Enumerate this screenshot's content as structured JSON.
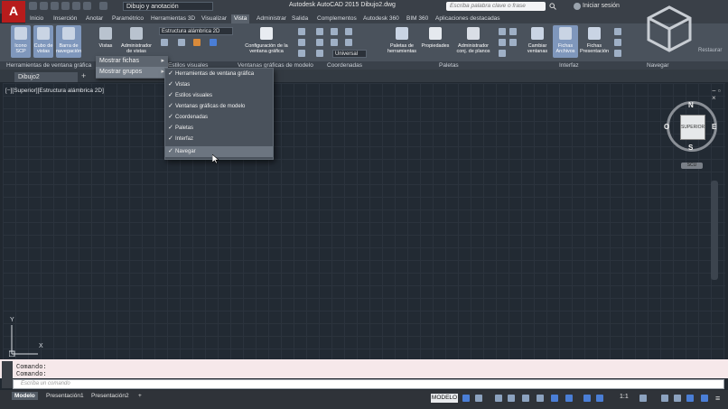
{
  "title_bar": {
    "workspace": "Dibujo y anotación",
    "app_title": "Autodesk AutoCAD 2015   Dibujo2.dwg",
    "search_placeholder": "Escriba palabra clave o frase",
    "signin": "Iniciar sesión"
  },
  "logo": "A",
  "ribbon_tabs": [
    "Inicio",
    "Inserción",
    "Anotar",
    "Paramétrico",
    "Herramientas 3D",
    "Visualizar",
    "Vista",
    "Administrar",
    "Salida",
    "Complementos",
    "Autodesk 360",
    "BIM 360",
    "Aplicaciones destacadas"
  ],
  "active_tab": "Vista",
  "ribbon": {
    "icono_scp": "Icono SCP",
    "cubo_vistas": "Cubo de vistas",
    "barra_nav": "Barra de navegación",
    "vistas": "Vistas",
    "admin_vistas": "Administrador de vistas",
    "visual_style": "Estructura alámbrica 2D",
    "config_ventana": "Configuración de la ventana gráfica",
    "coord_dd": "Universal",
    "paletas_herr": "Paletas de herramientas",
    "propiedades": "Propiedades",
    "admin_planos": "Administrador conj. de planos",
    "cambiar_ventanas": "Cambiar ventanas",
    "fichas_archivos": "Fichas Archivos",
    "fichas_presentacion": "Fichas Presentación",
    "restaurar": "Restaurar",
    "panels": [
      "Herramientas de ventana gráfica",
      "Estilos visuales",
      "Ventanas gráficas de modelo",
      "Coordenadas",
      "Paletas",
      "Interfaz",
      "Navegar"
    ]
  },
  "menu": {
    "items": [
      "Mostrar fichas",
      "Mostrar grupos"
    ]
  },
  "submenu": {
    "items": [
      "Herramientas de ventana gráfica",
      "Vistas",
      "Estilos visuales",
      "Ventanas gráficas de modelo",
      "Coordenadas",
      "Paletas",
      "Interfaz",
      "Navegar"
    ]
  },
  "file_tab": "Dibujo2",
  "viewport_label": "[−][Superior][Estructura alámbrica 2D]",
  "viewcube": {
    "face": "SUPERIOR",
    "n": "N",
    "s": "S",
    "e": "E",
    "o": "O",
    "wcs": "SCU"
  },
  "ucs": {
    "x": "X",
    "y": "Y"
  },
  "command": {
    "history": [
      "Comando:",
      "Comando:"
    ],
    "placeholder": "Escriba un comando"
  },
  "layout_tabs": [
    "Modelo",
    "Presentación1",
    "Presentación2"
  ],
  "status": {
    "model": "MODELO",
    "scale": "1:1"
  }
}
